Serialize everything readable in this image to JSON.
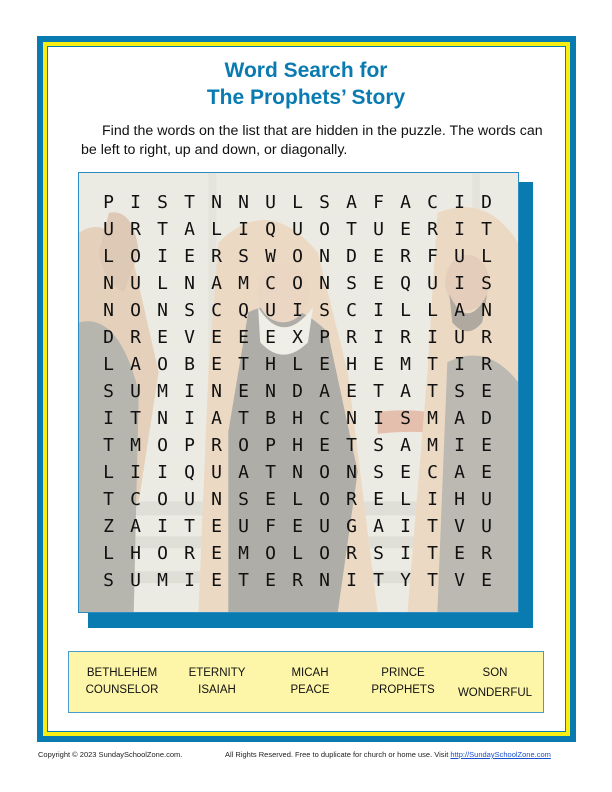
{
  "title": {
    "line1": "Word Search for",
    "line2": "The Prophets’ Story"
  },
  "instructions": "Find the words on the list that are hidden in the puzzle. The words can be left to right, up and down, or diagonally.",
  "colors": {
    "brand_blue": "#0a7bb0",
    "frame_yellow": "#f7ef12",
    "wordlist_bg": "#fdf5a8"
  },
  "puzzle": {
    "rows": [
      [
        "P",
        "I",
        "S",
        "T",
        "N",
        "N",
        "U",
        "L",
        "S",
        "A",
        "F",
        "A",
        "C",
        "I",
        "D"
      ],
      [
        "U",
        "R",
        "T",
        "A",
        "L",
        "I",
        "Q",
        "U",
        "O",
        "T",
        "U",
        "E",
        "R",
        "I",
        "T"
      ],
      [
        "L",
        "O",
        "I",
        "E",
        "R",
        "S",
        "W",
        "O",
        "N",
        "D",
        "E",
        "R",
        "F",
        "U",
        "L"
      ],
      [
        "N",
        "U",
        "L",
        "N",
        "A",
        "M",
        "C",
        "O",
        "N",
        "S",
        "E",
        "Q",
        "U",
        "I",
        "S"
      ],
      [
        "N",
        "O",
        "N",
        "S",
        "C",
        "Q",
        "U",
        "I",
        "S",
        "C",
        "I",
        "L",
        "L",
        "A",
        "N"
      ],
      [
        "D",
        "R",
        "E",
        "V",
        "E",
        "E",
        "E",
        "X",
        "P",
        "R",
        "I",
        "R",
        "I",
        "U",
        "R"
      ],
      [
        "L",
        "A",
        "O",
        "B",
        "E",
        "T",
        "H",
        "L",
        "E",
        "H",
        "E",
        "M",
        "T",
        "I",
        "R"
      ],
      [
        "S",
        "U",
        "M",
        "I",
        "N",
        "E",
        "N",
        "D",
        "A",
        "E",
        "T",
        "A",
        "T",
        "S",
        "E"
      ],
      [
        "I",
        "T",
        "N",
        "I",
        "A",
        "T",
        "B",
        "H",
        "C",
        "N",
        "I",
        "S",
        "M",
        "A",
        "D"
      ],
      [
        "T",
        "M",
        "O",
        "P",
        "R",
        "O",
        "P",
        "H",
        "E",
        "T",
        "S",
        "A",
        "M",
        "I",
        "E"
      ],
      [
        "L",
        "I",
        "I",
        "Q",
        "U",
        "A",
        "T",
        "N",
        "O",
        "N",
        "S",
        "E",
        "C",
        "A",
        "E"
      ],
      [
        "T",
        "C",
        "O",
        "U",
        "N",
        "S",
        "E",
        "L",
        "O",
        "R",
        "E",
        "L",
        "I",
        "H",
        "U"
      ],
      [
        "Z",
        "A",
        "I",
        "T",
        "E",
        "U",
        "F",
        "E",
        "U",
        "G",
        "A",
        "I",
        "T",
        "V",
        "U"
      ],
      [
        "L",
        "H",
        "O",
        "R",
        "E",
        "M",
        "O",
        "L",
        "O",
        "R",
        "S",
        "I",
        "T",
        "E",
        "R"
      ],
      [
        "S",
        "U",
        "M",
        "I",
        "E",
        "T",
        "E",
        "R",
        "N",
        "I",
        "T",
        "Y",
        "T",
        "V",
        "E"
      ]
    ]
  },
  "word_list": [
    [
      "BETHLEHEM",
      "COUNSELOR"
    ],
    [
      "ETERNITY",
      "ISAIAH"
    ],
    [
      "MICAH",
      "PEACE"
    ],
    [
      "PRINCE",
      "PROPHETS"
    ],
    [
      "SON",
      "WONDERFUL"
    ]
  ],
  "footer": {
    "copyright": "Copyright © 2023 SundaySchoolZone.com.",
    "rights": "All Rights Reserved. Free to duplicate for church or home use. Visit",
    "link_text": "http://SundaySchoolZone.com"
  }
}
